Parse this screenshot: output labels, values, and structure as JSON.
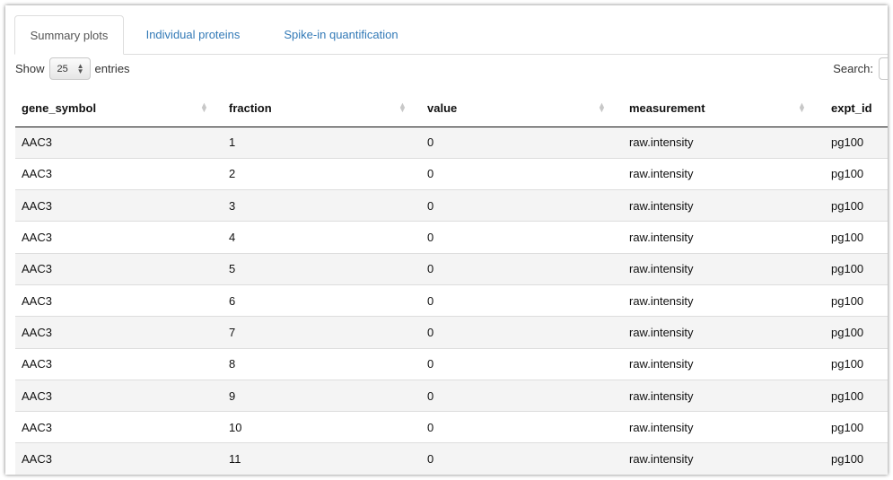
{
  "tabs": [
    {
      "label": "Summary plots",
      "active": true
    },
    {
      "label": "Individual proteins",
      "active": false
    },
    {
      "label": "Spike-in quantification",
      "active": false
    }
  ],
  "length_control": {
    "show_label": "Show",
    "selected": "25",
    "entries_label": "entries"
  },
  "search": {
    "label": "Search:",
    "value": ""
  },
  "table": {
    "columns": [
      "gene_symbol",
      "fraction",
      "value",
      "measurement",
      "expt_id"
    ],
    "rows": [
      [
        "AAC3",
        "1",
        "0",
        "raw.intensity",
        "pg100"
      ],
      [
        "AAC3",
        "2",
        "0",
        "raw.intensity",
        "pg100"
      ],
      [
        "AAC3",
        "3",
        "0",
        "raw.intensity",
        "pg100"
      ],
      [
        "AAC3",
        "4",
        "0",
        "raw.intensity",
        "pg100"
      ],
      [
        "AAC3",
        "5",
        "0",
        "raw.intensity",
        "pg100"
      ],
      [
        "AAC3",
        "6",
        "0",
        "raw.intensity",
        "pg100"
      ],
      [
        "AAC3",
        "7",
        "0",
        "raw.intensity",
        "pg100"
      ],
      [
        "AAC3",
        "8",
        "0",
        "raw.intensity",
        "pg100"
      ],
      [
        "AAC3",
        "9",
        "0",
        "raw.intensity",
        "pg100"
      ],
      [
        "AAC3",
        "10",
        "0",
        "raw.intensity",
        "pg100"
      ],
      [
        "AAC3",
        "11",
        "0",
        "raw.intensity",
        "pg100"
      ]
    ]
  },
  "colors": {
    "link": "#337ab7",
    "stripe": "#f4f4f4",
    "border": "#dddddd"
  }
}
